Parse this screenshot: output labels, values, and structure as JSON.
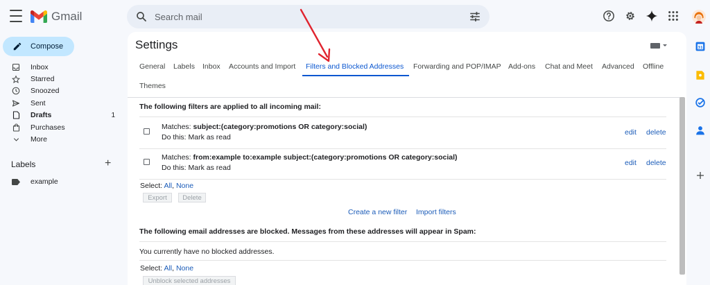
{
  "app": {
    "name": "Gmail"
  },
  "search": {
    "placeholder": "Search mail"
  },
  "compose": {
    "label": "Compose"
  },
  "nav": {
    "items": [
      {
        "label": "Inbox",
        "count": ""
      },
      {
        "label": "Starred",
        "count": ""
      },
      {
        "label": "Snoozed",
        "count": ""
      },
      {
        "label": "Sent",
        "count": ""
      },
      {
        "label": "Drafts",
        "count": "1"
      },
      {
        "label": "Purchases",
        "count": ""
      },
      {
        "label": "More",
        "count": ""
      }
    ]
  },
  "labels": {
    "title": "Labels",
    "items": [
      {
        "label": "example"
      }
    ]
  },
  "settings": {
    "title": "Settings",
    "tabs": [
      {
        "label": "General"
      },
      {
        "label": "Labels"
      },
      {
        "label": "Inbox"
      },
      {
        "label": "Accounts and Import"
      },
      {
        "label": "Filters and Blocked Addresses"
      },
      {
        "label": "Forwarding and POP/IMAP"
      },
      {
        "label": "Add-ons"
      },
      {
        "label": "Chat and Meet"
      },
      {
        "label": "Advanced"
      },
      {
        "label": "Offline"
      },
      {
        "label": "Themes"
      }
    ],
    "active_tab": "Filters and Blocked Addresses"
  },
  "filters": {
    "heading": "The following filters are applied to all incoming mail:",
    "rows": [
      {
        "matches_prefix": "Matches:",
        "criteria": "subject:(category:promotions OR category:social)",
        "action": "Do this: Mark as read",
        "edit": "edit",
        "delete": "delete"
      },
      {
        "matches_prefix": "Matches:",
        "criteria": "from:example to:example subject:(category:promotions OR category:social)",
        "action": "Do this: Mark as read",
        "edit": "edit",
        "delete": "delete"
      }
    ],
    "select_prefix": "Select:",
    "select_all": "All",
    "select_sep": ",",
    "select_none": "None",
    "export_label": "Export",
    "delete_label": "Delete",
    "create_filter": "Create a new filter",
    "import_filters": "Import filters"
  },
  "blocked": {
    "heading": "The following email addresses are blocked. Messages from these addresses will appear in Spam:",
    "empty_text": "You currently have no blocked addresses.",
    "select_prefix": "Select:",
    "select_all": "All",
    "select_sep": ",",
    "select_none": "None",
    "unblock_label": "Unblock selected addresses"
  },
  "colors": {
    "accent": "#0b57d0",
    "link": "#1a5bb8",
    "compose_bg": "#c2e7ff",
    "annotation_arrow": "#e0242f"
  }
}
